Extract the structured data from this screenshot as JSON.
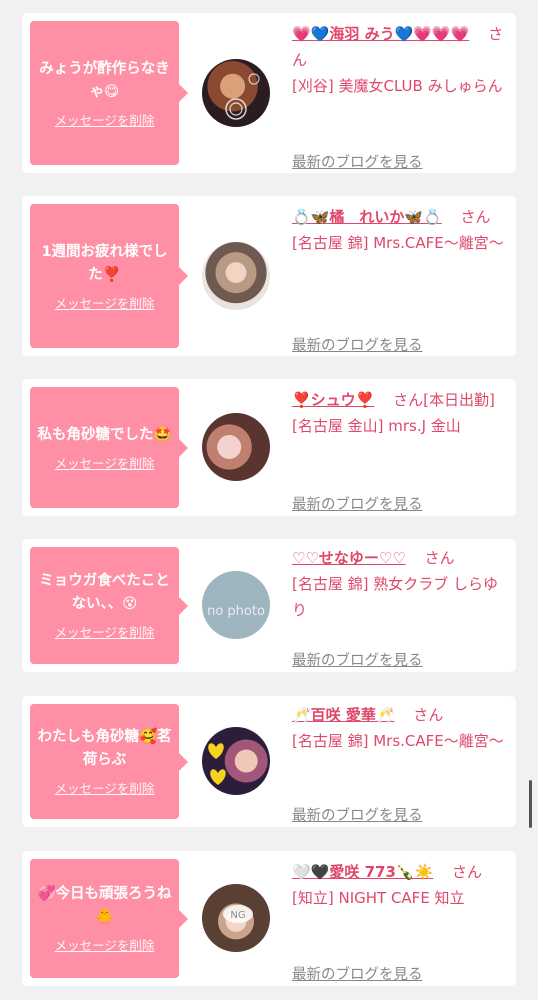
{
  "san_label": "さん",
  "delete_label": "メッセージを削除",
  "blog_label": "最新のブログを見る",
  "colors": {
    "bubble": "#ff8fa5",
    "accent": "#e0486b",
    "link_gray": "#888888"
  },
  "items": [
    {
      "message": "みょうが酢作らなきゃ😋",
      "name": "💗💙海羽 みう💙💗💗💗",
      "san_suffix": "",
      "shop": "[刈谷] 美魔女CLUB みしゅらん",
      "avatar": "photo"
    },
    {
      "message": "1週間お疲れ様でした❣️",
      "name": "💍🦋橘　れいか🦋💍",
      "san_suffix": "",
      "shop": "[名古屋 錦] Mrs.CAFE〜離宮〜",
      "avatar": "photo"
    },
    {
      "message": "私も角砂糖でした🤩",
      "name": "❣️シュウ❣️",
      "san_suffix": "[本日出勤]",
      "shop": "[名古屋 金山] mrs.J 金山",
      "avatar": "photo"
    },
    {
      "message": "ミョウガ食べたことない、、😵",
      "name": "♡♡せなゆー♡♡",
      "san_suffix": "",
      "shop": "[名古屋 錦] 熟女クラブ しらゆり",
      "avatar": "no photo"
    },
    {
      "message": "わたしも角砂糖🥰茗荷らぶ",
      "name": "🥂百咲 愛華🥂",
      "san_suffix": "",
      "shop": "[名古屋 錦] Mrs.CAFE〜離宮〜",
      "avatar": "photo"
    },
    {
      "message": "💞今日も頑張ろうね🐥",
      "name": "🤍🖤愛咲 773🍾☀️",
      "san_suffix": "",
      "shop": "[知立] NIGHT CAFE 知立",
      "avatar": "NG"
    }
  ]
}
